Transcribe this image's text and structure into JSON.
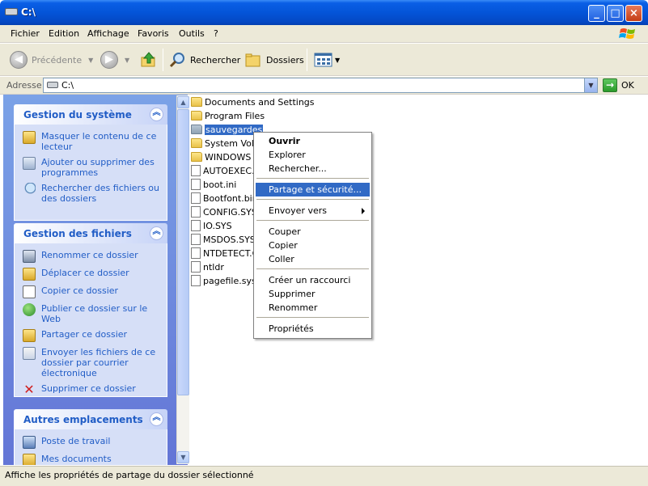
{
  "window": {
    "title": "C:\\"
  },
  "menu": [
    "Fichier",
    "Edition",
    "Affichage",
    "Favoris",
    "Outils",
    "?"
  ],
  "toolbar": {
    "back_label": "Précédente",
    "search_label": "Rechercher",
    "folders_label": "Dossiers"
  },
  "address": {
    "label": "Adresse",
    "value": "C:\\",
    "go_label": "OK"
  },
  "taskpane": {
    "system": {
      "title": "Gestion du système",
      "tasks": [
        "Masquer le contenu de ce lecteur",
        "Ajouter ou supprimer des programmes",
        "Rechercher des fichiers ou des dossiers"
      ]
    },
    "files": {
      "title": "Gestion des fichiers",
      "tasks": [
        "Renommer ce dossier",
        "Déplacer ce dossier",
        "Copier ce dossier",
        "Publier ce dossier sur le Web",
        "Partager ce dossier",
        "Envoyer les fichiers de ce dossier par courrier électronique",
        "Supprimer ce dossier"
      ]
    },
    "places": {
      "title": "Autres emplacements",
      "items": [
        "Poste de travail",
        "Mes documents"
      ]
    }
  },
  "files": [
    "Documents and Settings",
    "Program Files",
    "sauvegardes",
    "System Volu",
    "WINDOWS",
    "AUTOEXEC.B",
    "boot.ini",
    "Bootfont.bin",
    "CONFIG.SYS",
    "IO.SYS",
    "MSDOS.SYS",
    "NTDETECT.C",
    "ntldr",
    "pagefile.sys"
  ],
  "context_menu": {
    "open": "Ouvrir",
    "explore": "Explorer",
    "search": "Rechercher...",
    "sharing": "Partage et sécurité...",
    "send_to": "Envoyer vers",
    "cut": "Couper",
    "copy": "Copier",
    "paste": "Coller",
    "shortcut": "Créer un raccourci",
    "delete": "Supprimer",
    "rename": "Renommer",
    "properties": "Propriétés"
  },
  "status": {
    "text": "Affiche les propriétés de partage du dossier sélectionné"
  }
}
